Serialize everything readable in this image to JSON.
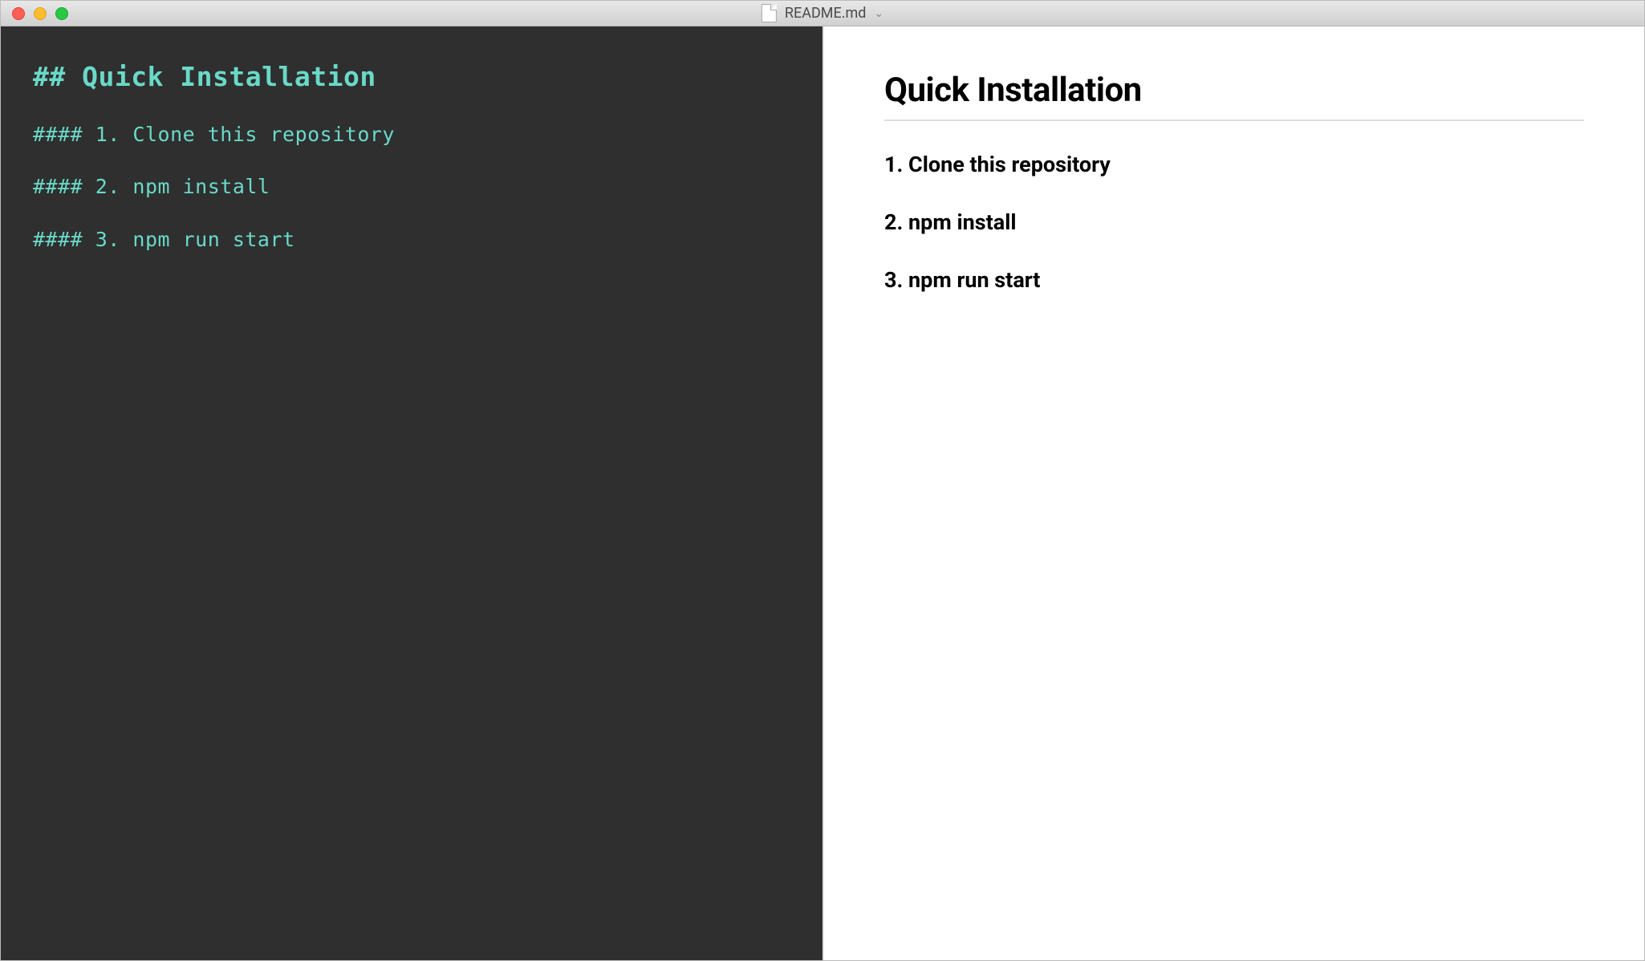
{
  "titlebar": {
    "filename": "README.md"
  },
  "editor": {
    "lines": [
      {
        "cls": "md-h2",
        "text": "## Quick Installation"
      },
      {
        "cls": "md-h4",
        "text": "#### 1. Clone this repository"
      },
      {
        "cls": "md-h4",
        "text": "#### 2. npm install"
      },
      {
        "cls": "md-h4",
        "text": "#### 3. npm run start"
      }
    ]
  },
  "preview": {
    "h2": "Quick Installation",
    "steps": [
      "1. Clone this repository",
      "2. npm install",
      "3. npm run start"
    ]
  }
}
